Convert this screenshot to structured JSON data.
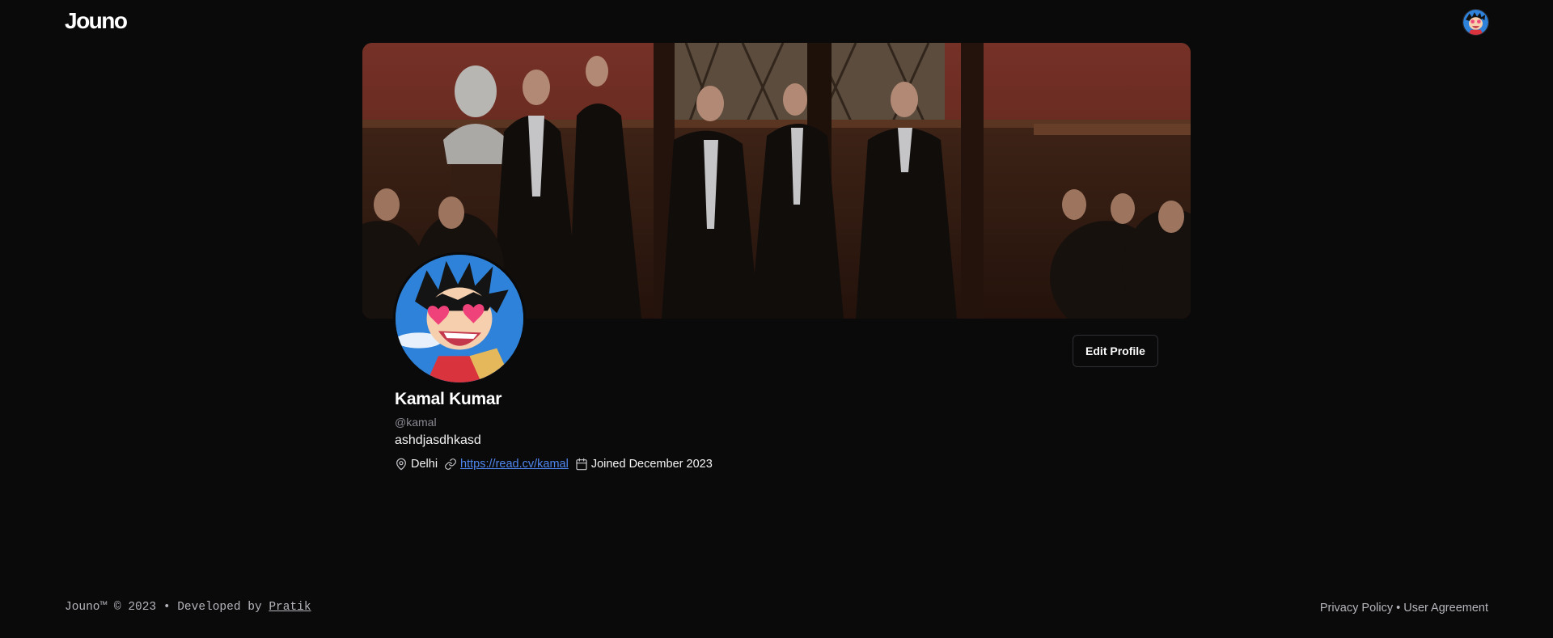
{
  "header": {
    "logo": "Jouno",
    "user_avatar_icon": "user-avatar-icon"
  },
  "profile": {
    "banner_image": "profile-banner-image",
    "avatar_image": "profile-avatar-image",
    "edit_label": "Edit Profile",
    "name": "Kamal Kumar",
    "handle": "@kamal",
    "bio": "ashdjasdhkasd",
    "location": "Delhi",
    "website": "https://read.cv/kamal",
    "joined": "Joined December 2023",
    "icons": [
      "map-pin-icon",
      "link-icon",
      "calendar-icon"
    ],
    "link_color": "#4f86ee"
  },
  "footer": {
    "copyright_prefix": "Jouno™ © 2023 • Developed by ",
    "developer": "Pratik",
    "privacy": "Privacy Policy",
    "separator": " • ",
    "agreement": "User Agreement"
  },
  "colors": {
    "background": "#0a0a0b",
    "text": "#fafafa",
    "muted": "#8a8a93",
    "border": "#2e2e33"
  }
}
